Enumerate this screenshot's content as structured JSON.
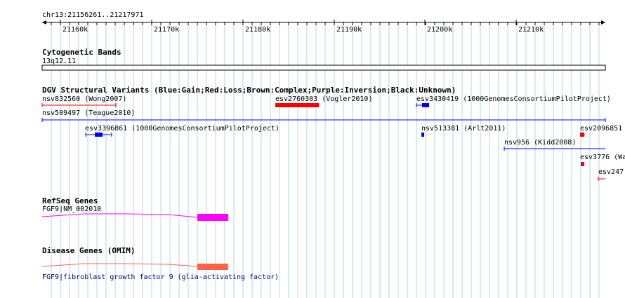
{
  "ruler": {
    "coordinate": "chr13:21156261..21217971",
    "ticks": [
      "21160k",
      "21170k",
      "21180k",
      "21190k",
      "21200k",
      "21210k"
    ]
  },
  "tracks": {
    "cytoband": {
      "title": "Cytogenetic Bands",
      "band": "13q12.11"
    },
    "dgv": {
      "title": "DGV Structural Variants (Blue:Gain;Red:Loss;Brown:Complex;Purple:Inversion;Black:Unknown)",
      "features": [
        {
          "label": "nsv832560 (Wong2007)",
          "type": "loss-line"
        },
        {
          "label": "esv2760303 (Vogler2010)",
          "type": "loss-box"
        },
        {
          "label": "esv3430419 (1000GenomesConsortiumPilotProject)",
          "type": "gain-box"
        },
        {
          "label": "nsv509497 (Teague2010)",
          "type": "gain-line"
        },
        {
          "label": "esv3396861 (1000GenomesConsortiumPilotProject)",
          "type": "gain-box"
        },
        {
          "label": "nsv513381 (Arlt2011)",
          "type": "gain-box"
        },
        {
          "label": "esv2096851",
          "type": "loss-box"
        },
        {
          "label": "nsv956 (Kidd2008)",
          "type": "gain-line"
        },
        {
          "label": "esv3776 (Wa",
          "type": "loss-box"
        },
        {
          "label": "esv247",
          "type": "loss-line"
        }
      ]
    },
    "refseq": {
      "title": "RefSeq Genes",
      "gene_label": "FGF9|NM_002010"
    },
    "omim": {
      "title": "Disease Genes (OMIM)",
      "gene_label": "FGF9|fibroblast growth factor 9 (glia-activating factor)"
    }
  },
  "colors": {
    "grid": "#add8e6",
    "gain": "#0000ff",
    "loss": "#ff0000",
    "refseq": "#ff00ff",
    "omim": "#ff6347"
  }
}
